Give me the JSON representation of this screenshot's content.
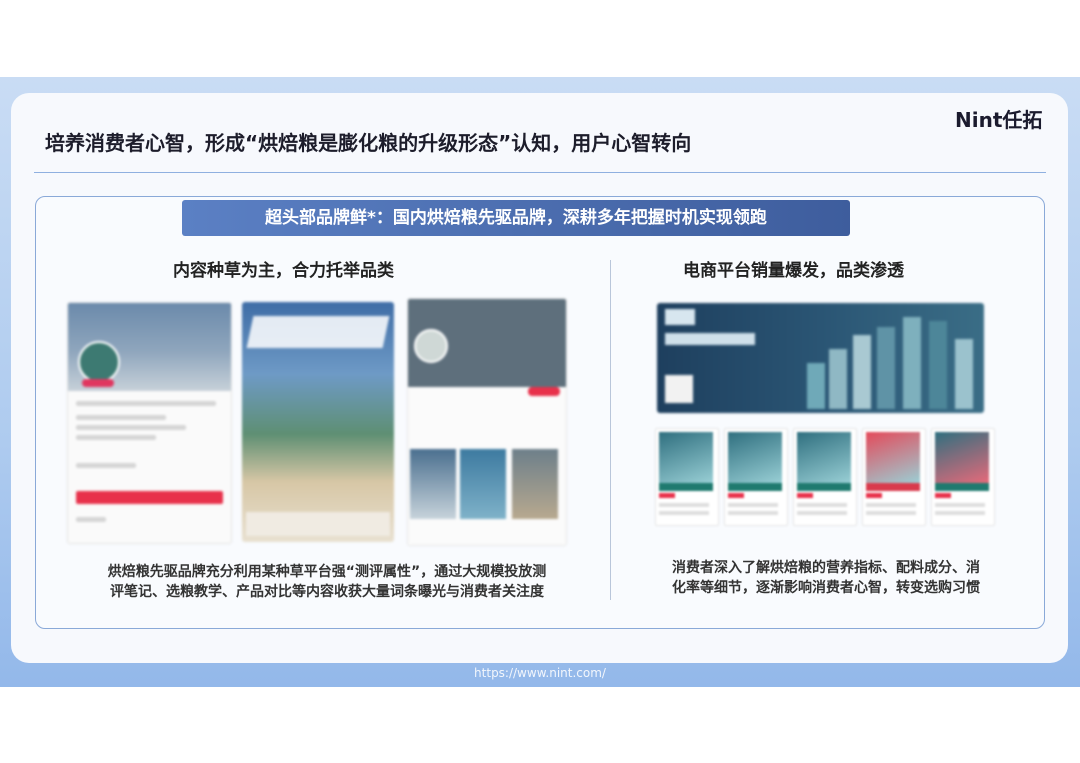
{
  "brand": {
    "logo": "Nint任拓"
  },
  "slide": {
    "title": "培养消费者心智，形成“烘焙粮是膨化粮的升级形态”认知，用户心智转向",
    "banner": "超头部品牌鲜*：国内烘焙粮先驱品牌，深耕多年把握时机实现领跑",
    "left": {
      "heading": "内容种草为主，合力托举品类",
      "description_line1": "烘焙粮先驱品牌充分利用某种草平台强“测评属性”，通过大规模投放测",
      "description_line2": "评笔记、选粮教学、产品对比等内容收获大量词条曝光与消费者关注度"
    },
    "right": {
      "heading": "电商平台销量爆发，品类渗透",
      "description_line1": "消费者深入了解烘焙粮的营养指标、配料成分、消",
      "description_line2": "化率等细节，逐渐影响消费者心智，转变选购习惯"
    }
  },
  "footer": {
    "url": "https://www.nint.com/"
  }
}
